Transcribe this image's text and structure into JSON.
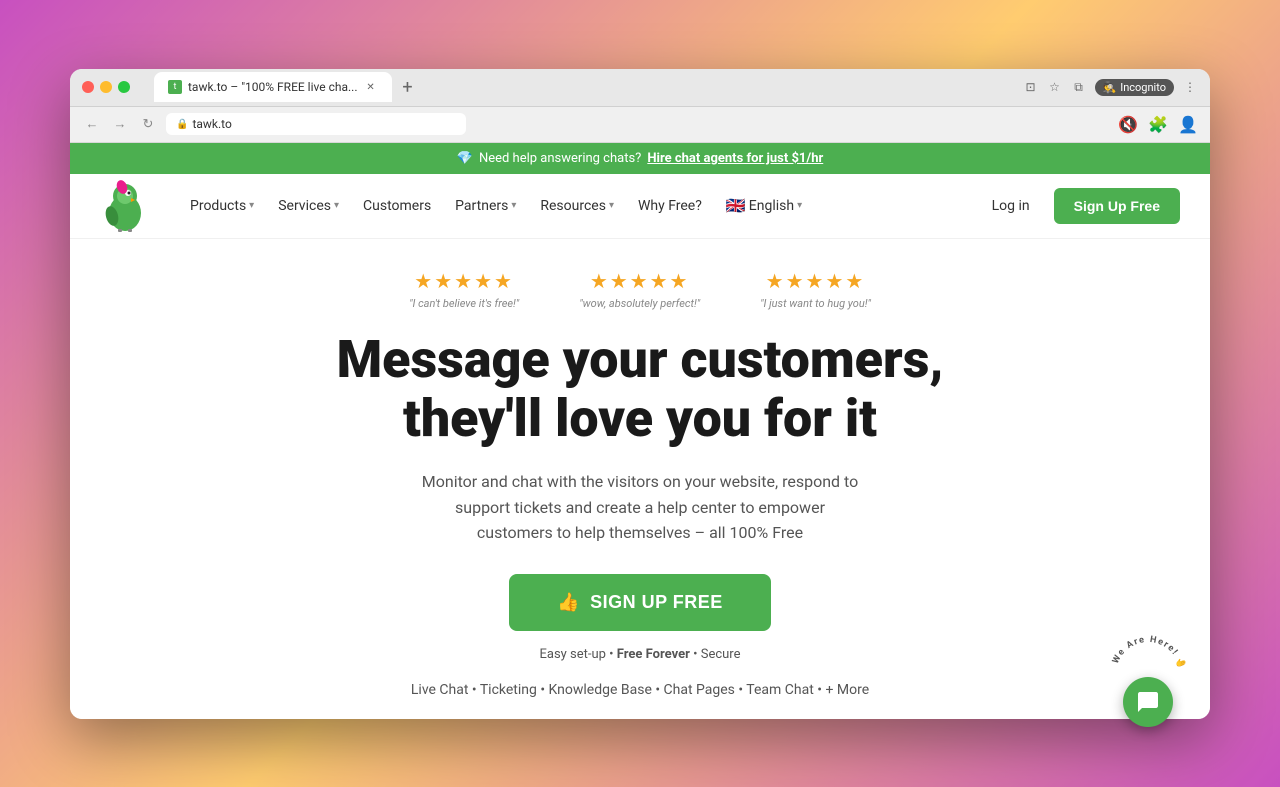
{
  "browser": {
    "tab_title": "tawk.to – \"100% FREE live cha...",
    "tab_new_label": "+",
    "url": "tawk.to",
    "incognito_label": "Incognito"
  },
  "announcement": {
    "diamond_icon": "💎",
    "text": "Need help answering chats?",
    "link_text": "Hire chat agents for just $1/hr"
  },
  "navbar": {
    "products_label": "Products",
    "services_label": "Services",
    "customers_label": "Customers",
    "partners_label": "Partners",
    "resources_label": "Resources",
    "why_free_label": "Why Free?",
    "language_label": "English",
    "login_label": "Log in",
    "signup_label": "Sign Up Free"
  },
  "hero": {
    "reviews": [
      {
        "stars": "★★★★★",
        "quote": "\"I can't believe it's free!\""
      },
      {
        "stars": "★★★★★",
        "quote": "\"wow, absolutely perfect!\""
      },
      {
        "stars": "★★★★★",
        "quote": "\"I just want to hug you!\""
      }
    ],
    "title_line1": "Message your customers,",
    "title_line2": "they'll love you for it",
    "subtitle": "Monitor and chat with the visitors on your website, respond to support tickets and create a help center to empower customers to help themselves – all 100% Free",
    "cta_label": "SIGN UP FREE",
    "cta_sub_prefix": "Easy set-up • ",
    "cta_sub_bold": "Free Forever",
    "cta_sub_suffix": " • Secure",
    "features": "Live Chat • Ticketing • Knowledge Base • Chat Pages • Team Chat • + More"
  },
  "chat_widget": {
    "we_are_here": "We Are Here!",
    "icon": "💬"
  }
}
